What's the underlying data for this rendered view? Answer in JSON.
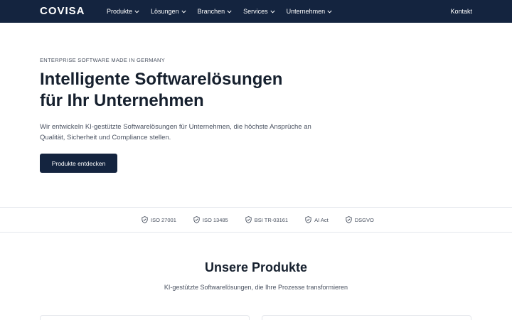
{
  "nav": {
    "logo": "COVISA",
    "items": [
      {
        "label": "Produkte"
      },
      {
        "label": "Lösungen"
      },
      {
        "label": "Branchen"
      },
      {
        "label": "Services"
      },
      {
        "label": "Unternehmen"
      }
    ],
    "contact": "Kontakt"
  },
  "hero": {
    "eyebrow": "ENTERPRISE SOFTWARE MADE IN GERMANY",
    "title_line1": "Intelligente Softwarelösungen",
    "title_line2": "für Ihr Unternehmen",
    "text": "Wir entwickeln KI-gestützte Softwarelösungen für Unternehmen, die höchste Ansprüche an Qualität, Sicherheit und Compliance stellen.",
    "cta": "Produkte entdecken"
  },
  "certifications": [
    {
      "label": "ISO 27001"
    },
    {
      "label": "ISO 13485"
    },
    {
      "label": "BSI TR-03161"
    },
    {
      "label": "AI Act"
    },
    {
      "label": "DSGVO"
    }
  ],
  "products": {
    "title": "Unsere Produkte",
    "subtitle": "KI-gestützte Softwarelösungen, die Ihre Prozesse transformieren"
  },
  "colors": {
    "nav_bg": "#14243f",
    "text_dark": "#16202e",
    "text_muted": "#4a5261",
    "border": "#e4e7ec"
  }
}
